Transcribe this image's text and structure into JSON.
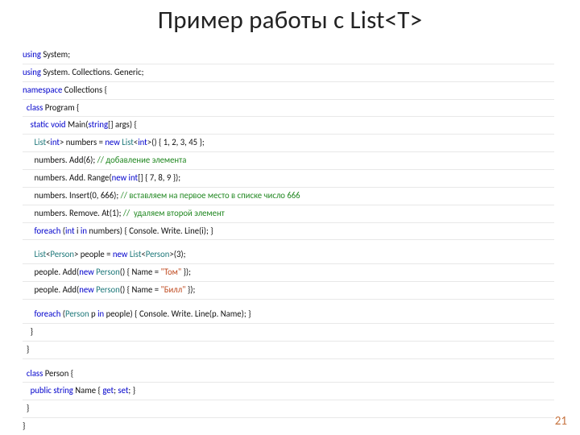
{
  "title": "Пример работы с List<T>",
  "page_number": "21",
  "code": {
    "l01a": "using",
    "l01b": " System;",
    "l02a": "using",
    "l02b": " System. Collections. Generic;",
    "l03a": "namespace",
    "l03b": " Collections {",
    "l04a": "class",
    "l04b": " Program {",
    "l05a": "static void",
    "l05b": " Main(",
    "l05c": "string",
    "l05d": "[] args) {",
    "l06a": "List",
    "l06b": "<",
    "l06c": "int",
    "l06d": "> numbers = ",
    "l06e": "new",
    "l06f": " List",
    "l06g": "<",
    "l06h": "int",
    "l06i": ">() { 1, 2, 3, 45 };",
    "l07a": "numbers. Add(6); ",
    "l07b": "// добавление элемента",
    "l08a": "numbers. Add. Range(",
    "l08b": "new int",
    "l08c": "[] { 7, 8, 9 });",
    "l09a": "numbers. Insert(0, 666); ",
    "l09b": "// вставляем на первое место в списке число 666",
    "l10a": "numbers. Remove. At(1); ",
    "l10b": "//  удаляем второй элемент",
    "l11a": "foreach",
    "l11b": " (",
    "l11c": "int",
    "l11d": " i ",
    "l11e": "in",
    "l11f": " numbers) { Console. Write. Line(i); }",
    "l12a": "List",
    "l12b": "<",
    "l12c": "Person",
    "l12d": "> people = ",
    "l12e": "new",
    "l12f": " List",
    "l12g": "<",
    "l12h": "Person",
    "l12i": ">(3);",
    "l13a": "people. Add(",
    "l13b": "new",
    "l13c": " Person",
    "l13d": "() { Name = ",
    "l13e": "\"Том\"",
    "l13f": " }); ",
    "l14a": "people. Add(",
    "l14b": "new",
    "l14c": " Person",
    "l14d": "() { Name = ",
    "l14e": "\"Билл\"",
    "l14f": " });",
    "l15a": "foreach",
    "l15b": " (",
    "l15c": "Person",
    "l15d": " p ",
    "l15e": "in",
    "l15f": " people) { Console. Write. Line(p. Name); }",
    "l16": "}",
    "l17": "}",
    "l18a": "class",
    "l18b": " Person {",
    "l19a": "public string",
    "l19b": " Name { ",
    "l19c": "get",
    "l19d": "; ",
    "l19e": "set",
    "l19f": "; }",
    "l20": "}",
    "l21": "}"
  }
}
